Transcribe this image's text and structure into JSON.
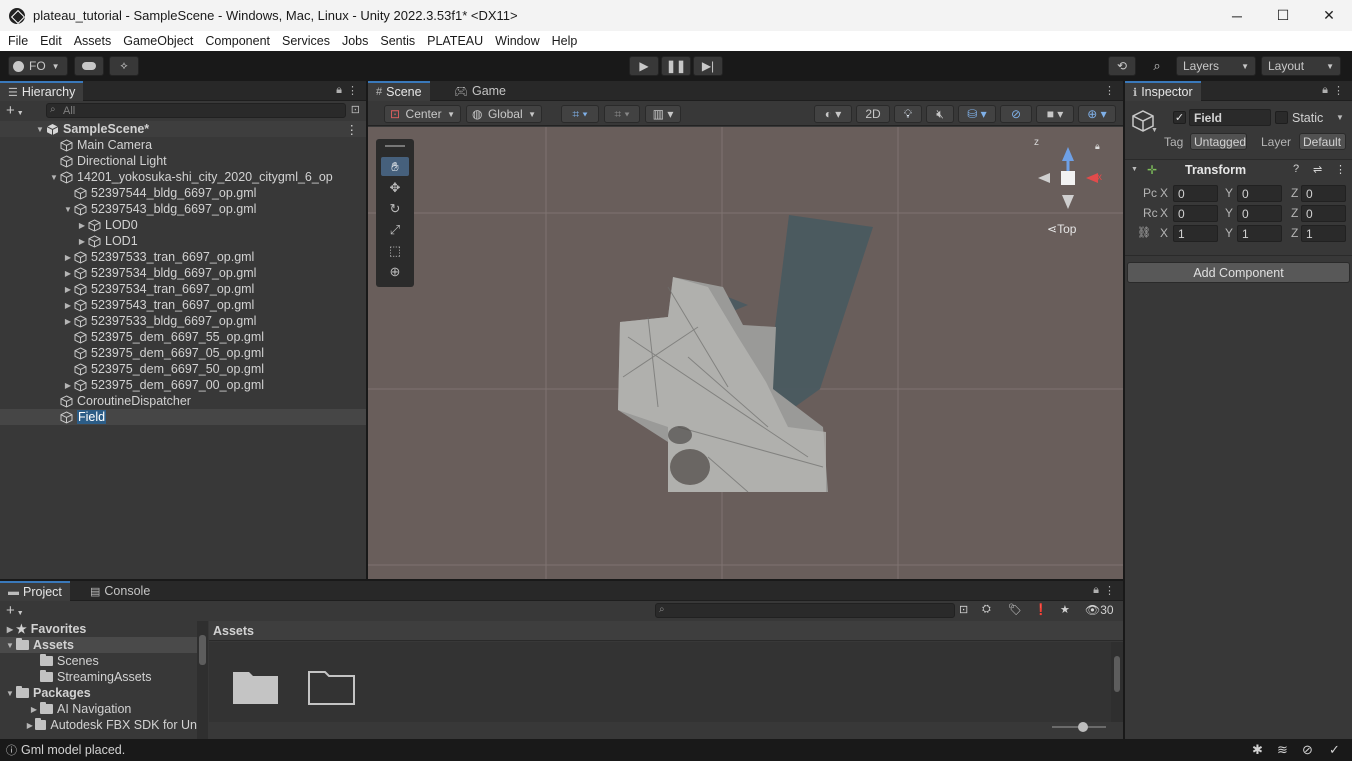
{
  "window": {
    "title": "plateau_tutorial - SampleScene - Windows, Mac, Linux - Unity 2022.3.53f1* <DX11>",
    "minimize": "─",
    "maximize": "☐",
    "close": "✕"
  },
  "menu": [
    "File",
    "Edit",
    "Assets",
    "GameObject",
    "Component",
    "Services",
    "Jobs",
    "Sentis",
    "PLATEAU",
    "Window",
    "Help"
  ],
  "toolbar": {
    "account": "FO",
    "layers": "Layers",
    "layout": "Layout"
  },
  "hierarchy": {
    "tab": "Hierarchy",
    "search_placeholder": "All",
    "add": "+",
    "items": [
      {
        "label": "SampleScene*",
        "depth": 0,
        "arrow": "▼",
        "scene": true
      },
      {
        "label": "Main Camera",
        "depth": 1,
        "arrow": ""
      },
      {
        "label": "Directional Light",
        "depth": 1,
        "arrow": ""
      },
      {
        "label": "14201_yokosuka-shi_city_2020_citygml_6_op",
        "depth": 1,
        "arrow": "▼"
      },
      {
        "label": "52397544_bldg_6697_op.gml",
        "depth": 2,
        "arrow": ""
      },
      {
        "label": "52397543_bldg_6697_op.gml",
        "depth": 2,
        "arrow": "▼"
      },
      {
        "label": "LOD0",
        "depth": 3,
        "arrow": "▶"
      },
      {
        "label": "LOD1",
        "depth": 3,
        "arrow": "▶"
      },
      {
        "label": "52397533_tran_6697_op.gml",
        "depth": 2,
        "arrow": "▶"
      },
      {
        "label": "52397534_bldg_6697_op.gml",
        "depth": 2,
        "arrow": "▶"
      },
      {
        "label": "52397534_tran_6697_op.gml",
        "depth": 2,
        "arrow": "▶"
      },
      {
        "label": "52397543_tran_6697_op.gml",
        "depth": 2,
        "arrow": "▶"
      },
      {
        "label": "52397533_bldg_6697_op.gml",
        "depth": 2,
        "arrow": "▶"
      },
      {
        "label": "523975_dem_6697_55_op.gml",
        "depth": 2,
        "arrow": ""
      },
      {
        "label": "523975_dem_6697_05_op.gml",
        "depth": 2,
        "arrow": ""
      },
      {
        "label": "523975_dem_6697_50_op.gml",
        "depth": 2,
        "arrow": ""
      },
      {
        "label": "523975_dem_6697_00_op.gml",
        "depth": 2,
        "arrow": "▶"
      },
      {
        "label": "CoroutineDispatcher",
        "depth": 1,
        "arrow": ""
      },
      {
        "label": "Field",
        "depth": 1,
        "arrow": "",
        "selected": true
      }
    ]
  },
  "scene": {
    "tabs": [
      "Scene",
      "Game"
    ],
    "pivot": "Center",
    "space": "Global",
    "mode_2d": "2D",
    "gizmo_label": "Top",
    "gizmo_axes": {
      "x": "x",
      "z": "z"
    }
  },
  "inspector": {
    "tab": "Inspector",
    "object_name": "Field",
    "static_label": "Static",
    "tag_label": "Tag",
    "tag_value": "Untagged",
    "layer_label": "Layer",
    "layer_value": "Default",
    "component": "Transform",
    "rows": [
      {
        "label": "Pc",
        "x": "0",
        "y": "0",
        "z": "0"
      },
      {
        "label": "Rc",
        "x": "0",
        "y": "0",
        "z": "0"
      },
      {
        "label": "",
        "x": "1",
        "y": "1",
        "z": "1"
      }
    ],
    "axis_labels": [
      "X",
      "Y",
      "Z"
    ],
    "add_component": "Add Component"
  },
  "project": {
    "tabs": [
      "Project",
      "Console"
    ],
    "add": "+",
    "badge_count": "30",
    "breadcrumb": "Assets",
    "tree": [
      {
        "label": "Favorites",
        "depth": 0,
        "arrow": "▶",
        "icon": "star",
        "bold": true
      },
      {
        "label": "Assets",
        "depth": 0,
        "arrow": "▼",
        "icon": "folder",
        "bold": true,
        "selected": true
      },
      {
        "label": "Scenes",
        "depth": 1,
        "arrow": "",
        "icon": "folder"
      },
      {
        "label": "StreamingAssets",
        "depth": 1,
        "arrow": "",
        "icon": "folder"
      },
      {
        "label": "Packages",
        "depth": 0,
        "arrow": "▼",
        "icon": "folder",
        "bold": true
      },
      {
        "label": "AI Navigation",
        "depth": 1,
        "arrow": "▶",
        "icon": "folder"
      },
      {
        "label": "Autodesk FBX SDK for Un",
        "depth": 1,
        "arrow": "▶",
        "icon": "folder"
      }
    ]
  },
  "status": {
    "message": "Gml model placed."
  }
}
